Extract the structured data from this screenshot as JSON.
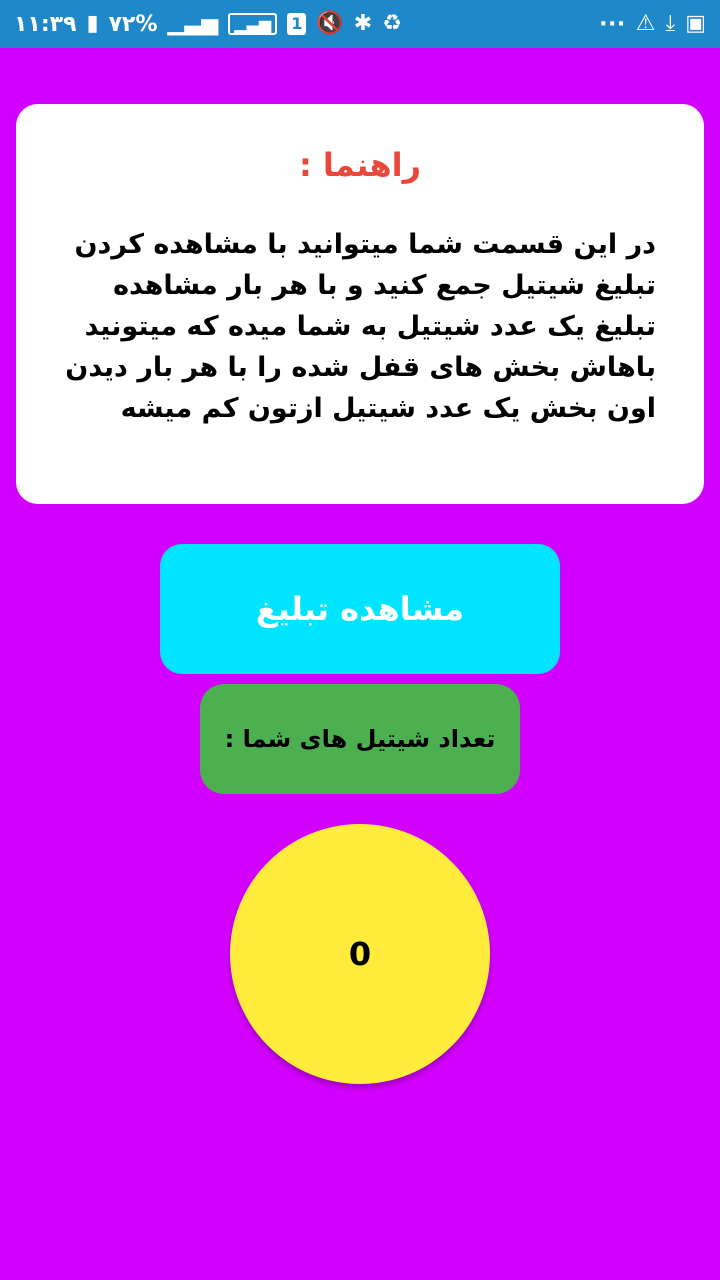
{
  "status_bar": {
    "time": "۱۱:۳۹",
    "battery": "۷۲%",
    "sim_badge": "1",
    "more": "···"
  },
  "guide": {
    "title": "راهنما :",
    "body": "در این قسمت شما میتوانید با مشاهده کردن تبلیغ شیتیل جمع کنید و با هر بار مشاهده تبلیغ یک عدد شیتیل به شما میده که میتونید باهاش بخش های قفل شده را با هر بار دیدن اون بخش یک عدد شیتیل ازتون کم میشه"
  },
  "watch_ad_button": {
    "label": "مشاهده تبلیغ"
  },
  "coin_count": {
    "label": "تعداد شیتیل های شما :",
    "value": "0"
  },
  "colors": {
    "background": "#d400ff",
    "status_bar": "#1e88c9",
    "title": "#e8473a",
    "button": "#00e5ff",
    "count_box": "#4caf50",
    "circle": "#ffeb3b"
  }
}
